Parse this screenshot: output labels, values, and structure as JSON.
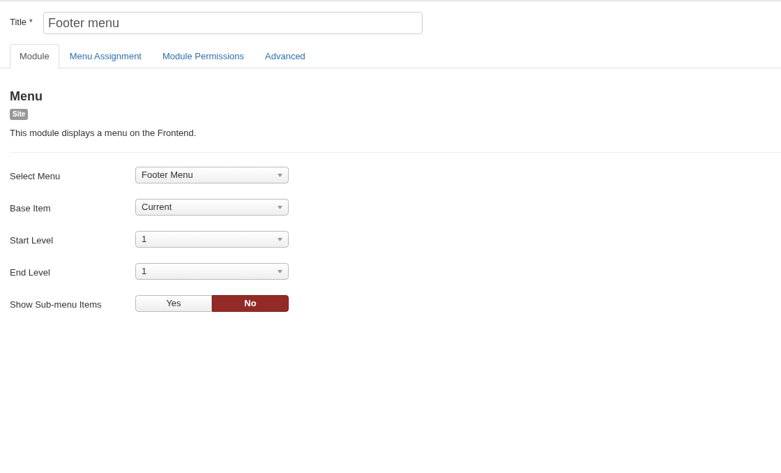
{
  "title_field": {
    "label": "Title *",
    "value": "Footer menu"
  },
  "tabs": [
    {
      "label": "Module",
      "selected": true
    },
    {
      "label": "Menu Assignment",
      "selected": false
    },
    {
      "label": "Module Permissions",
      "selected": false
    },
    {
      "label": "Advanced",
      "selected": false
    }
  ],
  "module": {
    "heading": "Menu",
    "badge": "Site",
    "description": "This module displays a menu on the Frontend."
  },
  "fields": [
    {
      "kind": "select",
      "label": "Select Menu",
      "value": "Footer Menu"
    },
    {
      "kind": "select",
      "label": "Base Item",
      "value": "Current"
    },
    {
      "kind": "select",
      "label": "Start Level",
      "value": "1"
    },
    {
      "kind": "select",
      "label": "End Level",
      "value": "1"
    },
    {
      "kind": "toggle",
      "label": "Show Sub-menu Items",
      "options": [
        {
          "label": "Yes",
          "selected": false
        },
        {
          "label": "No",
          "selected": true
        }
      ]
    }
  ]
}
